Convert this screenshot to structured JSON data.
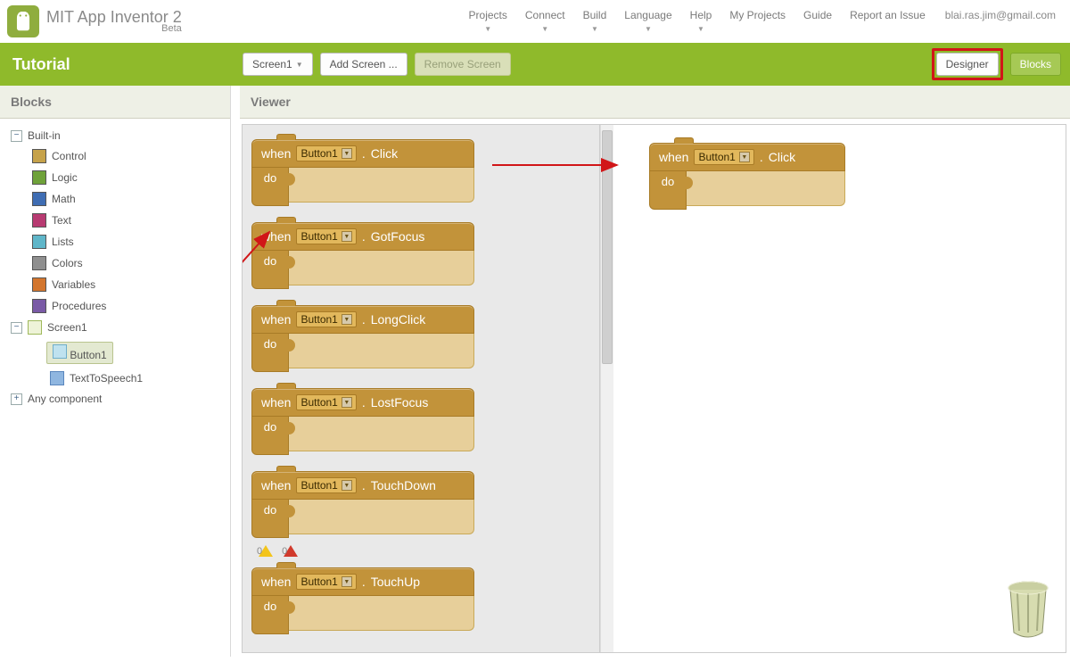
{
  "app": {
    "title": "MIT App Inventor 2",
    "beta": "Beta"
  },
  "nav": {
    "items": [
      {
        "label": "Projects",
        "dd": true
      },
      {
        "label": "Connect",
        "dd": true
      },
      {
        "label": "Build",
        "dd": true
      },
      {
        "label": "Language",
        "dd": true
      },
      {
        "label": "Help",
        "dd": true
      },
      {
        "label": "My Projects",
        "dd": false
      },
      {
        "label": "Guide",
        "dd": false
      },
      {
        "label": "Report an Issue",
        "dd": false
      }
    ],
    "email": "blai.ras.jim@gmail.com"
  },
  "actionbar": {
    "project": "Tutorial",
    "screen": "Screen1",
    "add": "Add Screen ...",
    "remove": "Remove Screen",
    "designer": "Designer",
    "blocks": "Blocks"
  },
  "sidebar": {
    "title": "Blocks",
    "groups": {
      "builtin": "Built-in",
      "categories": [
        {
          "label": "Control",
          "color": "#c6a24a"
        },
        {
          "label": "Logic",
          "color": "#6fa23a"
        },
        {
          "label": "Math",
          "color": "#3f6db3"
        },
        {
          "label": "Text",
          "color": "#b83b72"
        },
        {
          "label": "Lists",
          "color": "#5fb6c9"
        },
        {
          "label": "Colors",
          "color": "#8f8f8f"
        },
        {
          "label": "Variables",
          "color": "#d3762e"
        },
        {
          "label": "Procedures",
          "color": "#7a5aa6"
        }
      ],
      "screen": "Screen1",
      "components": [
        {
          "label": "Button1",
          "icon": "button",
          "selected": true
        },
        {
          "label": "TextToSpeech1",
          "icon": "speech",
          "selected": false
        }
      ],
      "any": "Any component"
    }
  },
  "viewer": {
    "title": "Viewer",
    "component": "Button1",
    "when": "when",
    "do": "do",
    "events": [
      "Click",
      "GotFocus",
      "LongClick",
      "LostFocus",
      "TouchDown",
      "TouchUp"
    ],
    "canvas_event": "Click",
    "warn_y": "0",
    "warn_r": "0"
  }
}
